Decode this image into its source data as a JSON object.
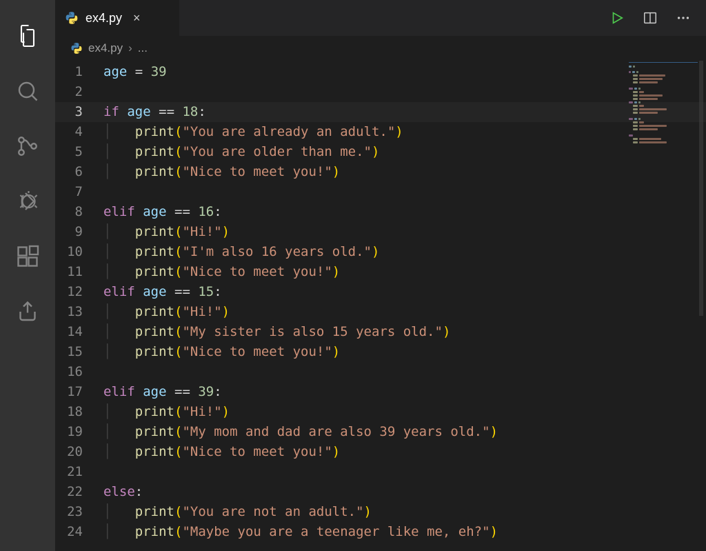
{
  "tab": {
    "filename": "ex4.py",
    "close_glyph": "×"
  },
  "breadcrumb": {
    "filename": "ex4.py",
    "rest_glyph": "..."
  },
  "active_line_index": 2,
  "code_lines": [
    {
      "num": 1,
      "tokens": [
        {
          "c": "tk-var",
          "t": "age"
        },
        {
          "c": "tk-pl",
          "t": " "
        },
        {
          "c": "tk-op",
          "t": "="
        },
        {
          "c": "tk-pl",
          "t": " "
        },
        {
          "c": "tk-num",
          "t": "39"
        }
      ]
    },
    {
      "num": 2,
      "tokens": []
    },
    {
      "num": 3,
      "tokens": [
        {
          "c": "tk-kw",
          "t": "if"
        },
        {
          "c": "tk-pl",
          "t": " "
        },
        {
          "c": "tk-var",
          "t": "age"
        },
        {
          "c": "tk-pl",
          "t": " "
        },
        {
          "c": "tk-op",
          "t": "=="
        },
        {
          "c": "tk-pl",
          "t": " "
        },
        {
          "c": "tk-num",
          "t": "18"
        },
        {
          "c": "tk-pl",
          "t": ":"
        }
      ]
    },
    {
      "num": 4,
      "indent": 1,
      "tokens": [
        {
          "c": "tk-fn",
          "t": "print"
        },
        {
          "c": "tk-pn",
          "t": "("
        },
        {
          "c": "tk-str",
          "t": "\"You are already an adult.\""
        },
        {
          "c": "tk-pn",
          "t": ")"
        }
      ]
    },
    {
      "num": 5,
      "indent": 1,
      "tokens": [
        {
          "c": "tk-fn",
          "t": "print"
        },
        {
          "c": "tk-pn",
          "t": "("
        },
        {
          "c": "tk-str",
          "t": "\"You are older than me.\""
        },
        {
          "c": "tk-pn",
          "t": ")"
        }
      ]
    },
    {
      "num": 6,
      "indent": 1,
      "tokens": [
        {
          "c": "tk-fn",
          "t": "print"
        },
        {
          "c": "tk-pn",
          "t": "("
        },
        {
          "c": "tk-str",
          "t": "\"Nice to meet you!\""
        },
        {
          "c": "tk-pn",
          "t": ")"
        }
      ]
    },
    {
      "num": 7,
      "tokens": []
    },
    {
      "num": 8,
      "tokens": [
        {
          "c": "tk-kw",
          "t": "elif"
        },
        {
          "c": "tk-pl",
          "t": " "
        },
        {
          "c": "tk-var",
          "t": "age"
        },
        {
          "c": "tk-pl",
          "t": " "
        },
        {
          "c": "tk-op",
          "t": "=="
        },
        {
          "c": "tk-pl",
          "t": " "
        },
        {
          "c": "tk-num",
          "t": "16"
        },
        {
          "c": "tk-pl",
          "t": ":"
        }
      ]
    },
    {
      "num": 9,
      "indent": 1,
      "tokens": [
        {
          "c": "tk-fn",
          "t": "print"
        },
        {
          "c": "tk-pn",
          "t": "("
        },
        {
          "c": "tk-str",
          "t": "\"Hi!\""
        },
        {
          "c": "tk-pn",
          "t": ")"
        }
      ]
    },
    {
      "num": 10,
      "indent": 1,
      "tokens": [
        {
          "c": "tk-fn",
          "t": "print"
        },
        {
          "c": "tk-pn",
          "t": "("
        },
        {
          "c": "tk-str",
          "t": "\"I'm also 16 years old.\""
        },
        {
          "c": "tk-pn",
          "t": ")"
        }
      ]
    },
    {
      "num": 11,
      "indent": 1,
      "tokens": [
        {
          "c": "tk-fn",
          "t": "print"
        },
        {
          "c": "tk-pn",
          "t": "("
        },
        {
          "c": "tk-str",
          "t": "\"Nice to meet you!\""
        },
        {
          "c": "tk-pn",
          "t": ")"
        }
      ]
    },
    {
      "num": 12,
      "tokens": [
        {
          "c": "tk-kw",
          "t": "elif"
        },
        {
          "c": "tk-pl",
          "t": " "
        },
        {
          "c": "tk-var",
          "t": "age"
        },
        {
          "c": "tk-pl",
          "t": " "
        },
        {
          "c": "tk-op",
          "t": "=="
        },
        {
          "c": "tk-pl",
          "t": " "
        },
        {
          "c": "tk-num",
          "t": "15"
        },
        {
          "c": "tk-pl",
          "t": ":"
        }
      ]
    },
    {
      "num": 13,
      "indent": 1,
      "tokens": [
        {
          "c": "tk-fn",
          "t": "print"
        },
        {
          "c": "tk-pn",
          "t": "("
        },
        {
          "c": "tk-str",
          "t": "\"Hi!\""
        },
        {
          "c": "tk-pn",
          "t": ")"
        }
      ]
    },
    {
      "num": 14,
      "indent": 1,
      "tokens": [
        {
          "c": "tk-fn",
          "t": "print"
        },
        {
          "c": "tk-pn",
          "t": "("
        },
        {
          "c": "tk-str",
          "t": "\"My sister is also 15 years old.\""
        },
        {
          "c": "tk-pn",
          "t": ")"
        }
      ]
    },
    {
      "num": 15,
      "indent": 1,
      "tokens": [
        {
          "c": "tk-fn",
          "t": "print"
        },
        {
          "c": "tk-pn",
          "t": "("
        },
        {
          "c": "tk-str",
          "t": "\"Nice to meet you!\""
        },
        {
          "c": "tk-pn",
          "t": ")"
        }
      ]
    },
    {
      "num": 16,
      "tokens": []
    },
    {
      "num": 17,
      "tokens": [
        {
          "c": "tk-kw",
          "t": "elif"
        },
        {
          "c": "tk-pl",
          "t": " "
        },
        {
          "c": "tk-var",
          "t": "age"
        },
        {
          "c": "tk-pl",
          "t": " "
        },
        {
          "c": "tk-op",
          "t": "=="
        },
        {
          "c": "tk-pl",
          "t": " "
        },
        {
          "c": "tk-num",
          "t": "39"
        },
        {
          "c": "tk-pl",
          "t": ":"
        }
      ]
    },
    {
      "num": 18,
      "indent": 1,
      "tokens": [
        {
          "c": "tk-fn",
          "t": "print"
        },
        {
          "c": "tk-pn",
          "t": "("
        },
        {
          "c": "tk-str",
          "t": "\"Hi!\""
        },
        {
          "c": "tk-pn",
          "t": ")"
        }
      ]
    },
    {
      "num": 19,
      "indent": 1,
      "tokens": [
        {
          "c": "tk-fn",
          "t": "print"
        },
        {
          "c": "tk-pn",
          "t": "("
        },
        {
          "c": "tk-str",
          "t": "\"My mom and dad are also 39 years old.\""
        },
        {
          "c": "tk-pn",
          "t": ")"
        }
      ]
    },
    {
      "num": 20,
      "indent": 1,
      "tokens": [
        {
          "c": "tk-fn",
          "t": "print"
        },
        {
          "c": "tk-pn",
          "t": "("
        },
        {
          "c": "tk-str",
          "t": "\"Nice to meet you!\""
        },
        {
          "c": "tk-pn",
          "t": ")"
        }
      ]
    },
    {
      "num": 21,
      "tokens": []
    },
    {
      "num": 22,
      "tokens": [
        {
          "c": "tk-kw",
          "t": "else"
        },
        {
          "c": "tk-pl",
          "t": ":"
        }
      ]
    },
    {
      "num": 23,
      "indent": 1,
      "tokens": [
        {
          "c": "tk-fn",
          "t": "print"
        },
        {
          "c": "tk-pn",
          "t": "("
        },
        {
          "c": "tk-str",
          "t": "\"You are not an adult.\""
        },
        {
          "c": "tk-pn",
          "t": ")"
        }
      ]
    },
    {
      "num": 24,
      "indent": 1,
      "tokens": [
        {
          "c": "tk-fn",
          "t": "print"
        },
        {
          "c": "tk-pn",
          "t": "("
        },
        {
          "c": "tk-str",
          "t": "\"Maybe you are a teenager like me, eh?\""
        },
        {
          "c": "tk-pn",
          "t": ")"
        }
      ]
    }
  ]
}
